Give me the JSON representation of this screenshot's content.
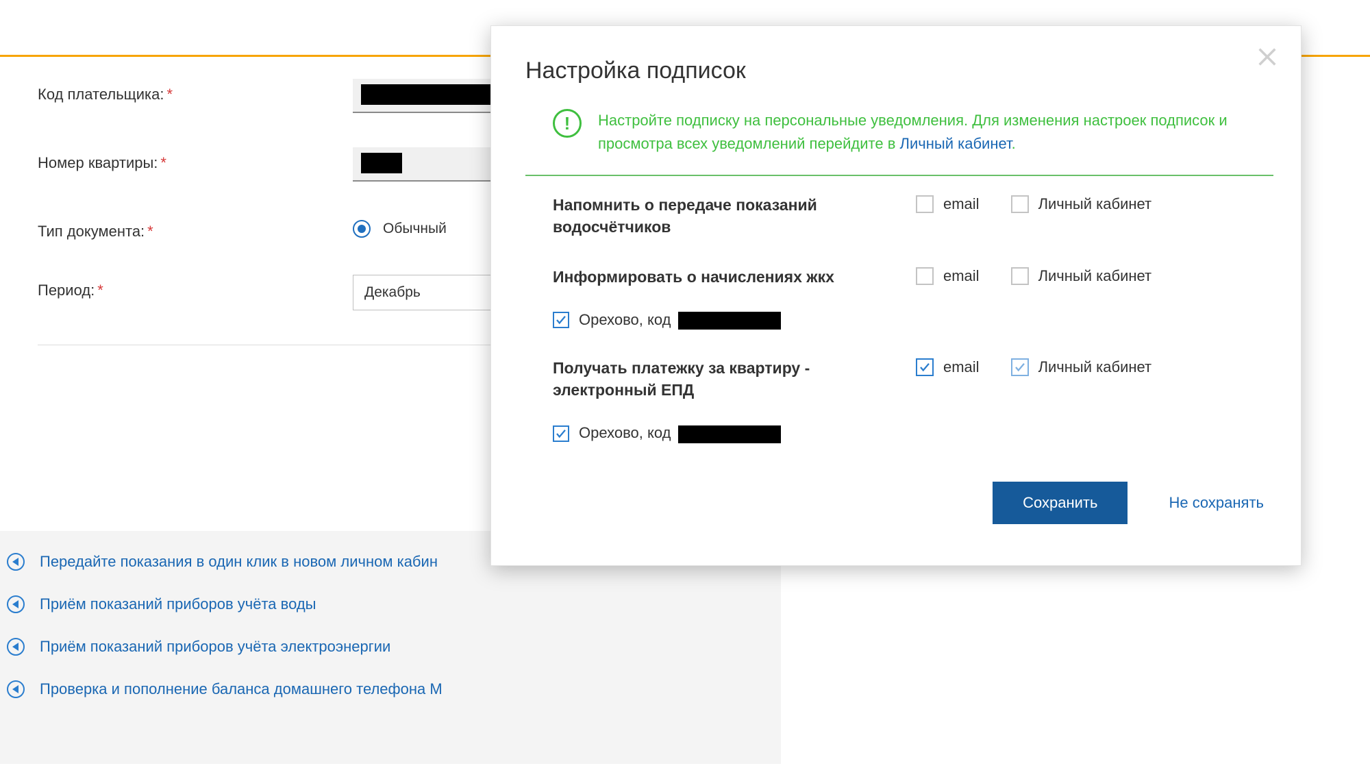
{
  "form": {
    "payer_code_label": "Код плательщика:",
    "apartment_label": "Номер квартиры:",
    "doc_type_label": "Тип документа:",
    "doc_type_value": "Обычный",
    "period_label": "Период:",
    "period_value": "Декабрь"
  },
  "links": {
    "items": [
      "Передайте показания в один клик в новом личном кабин",
      "Приём показаний приборов учёта воды",
      "Приём показаний приборов учёта электроэнергии",
      "Проверка и пополнение баланса домашнего телефона М"
    ]
  },
  "modal": {
    "title": "Настройка подписок",
    "alert_text_a": "Настройте подписку на персональные уведомления. Для изменения настроек подписок и просмотра всех уведомлений перейдите в ",
    "alert_link": "Личный кабинет",
    "alert_text_b": ".",
    "checkbox_email": "email",
    "checkbox_lk": "Личный кабинет",
    "subscriptions": [
      {
        "title": "Напомнить о передаче показаний водосчётчиков",
        "email": false,
        "lk": false,
        "lk_disabled": false
      },
      {
        "title": "Информировать о начислениях жкх",
        "email": false,
        "lk": false,
        "lk_disabled": false
      },
      {
        "title": "Получать платежку за квартиру - электронный ЕПД",
        "email": true,
        "lk": true,
        "lk_disabled": true
      }
    ],
    "sub_item_prefix": "Орехово, код",
    "footer_save": "Сохранить",
    "footer_cancel": "Не сохранять"
  }
}
